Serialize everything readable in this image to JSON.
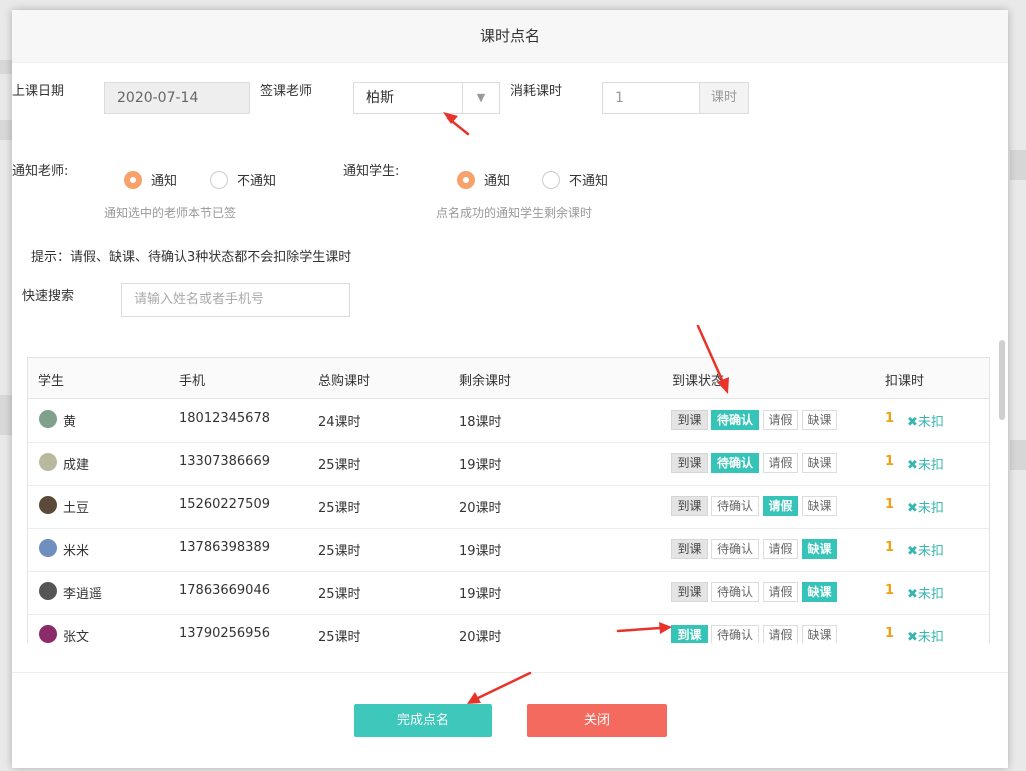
{
  "modal": {
    "title": "课时点名"
  },
  "form": {
    "date_label": "上课日期",
    "date_value": "2020-07-14",
    "teacher_label": "签课老师",
    "teacher_value": "柏斯",
    "consume_label": "消耗课时",
    "consume_value": "1",
    "consume_unit": "课时",
    "notify_teacher_label": "通知老师:",
    "notify_teacher_options": [
      "通知",
      "不通知"
    ],
    "notify_teacher_selected": "通知",
    "notify_teacher_hint": "通知选中的老师本节已签",
    "notify_student_label": "通知学生:",
    "notify_student_options": [
      "通知",
      "不通知"
    ],
    "notify_student_selected": "通知",
    "notify_student_hint": "点名成功的通知学生剩余课时",
    "tip": "提示：请假、缺课、待确认3种状态都不会扣除学生课时",
    "search_label": "快速搜索",
    "search_placeholder": "请输入姓名或者手机号"
  },
  "table": {
    "headers": [
      "学生",
      "手机",
      "总购课时",
      "剩余课时",
      "到课状态",
      "扣课时"
    ],
    "status_options": [
      "到课",
      "待确认",
      "请假",
      "缺课"
    ],
    "deduct_undone": "✖未扣",
    "rows": [
      {
        "name": "黄",
        "phone": "18012345678",
        "total": "24课时",
        "remaining": "18课时",
        "status": "待确认",
        "deduct": "1",
        "avatar_color": "#7fa08a"
      },
      {
        "name": "成建",
        "phone": "13307386669",
        "total": "25课时",
        "remaining": "19课时",
        "status": "待确认",
        "deduct": "1",
        "avatar_color": "#b9b9a0"
      },
      {
        "name": "土豆",
        "phone": "15260227509",
        "total": "25课时",
        "remaining": "20课时",
        "status": "请假",
        "deduct": "1",
        "avatar_color": "#5b4a3a"
      },
      {
        "name": "米米",
        "phone": "13786398389",
        "total": "25课时",
        "remaining": "19课时",
        "status": "缺课",
        "deduct": "1",
        "avatar_color": "#6f8fbf"
      },
      {
        "name": "李逍遥",
        "phone": "17863669046",
        "total": "25课时",
        "remaining": "19课时",
        "status": "缺课",
        "deduct": "1",
        "avatar_color": "#555555"
      },
      {
        "name": "张文",
        "phone": "13790256956",
        "total": "25课时",
        "remaining": "20课时",
        "status": "到课",
        "deduct": "1",
        "avatar_color": "#8a2b6a"
      }
    ]
  },
  "footer": {
    "finish_label": "完成点名",
    "close_label": "关闭"
  },
  "colors": {
    "accent": "#35c4b7",
    "radio": "#f7a26b",
    "danger": "#f56a5f",
    "deduct": "#f0a010",
    "annotation_arrow": "#e8332a"
  }
}
